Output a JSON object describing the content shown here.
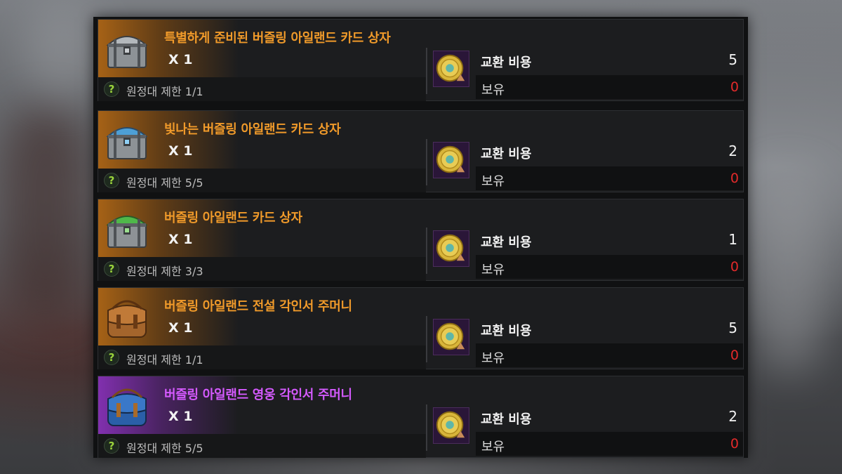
{
  "shop_rows": [
    {
      "item_icon": "silver-chest-icon",
      "item_name": "특별하게 준비된 버즐링 아일랜드 카드 상자",
      "name_color": "#f09a2a",
      "quantity": "X 1",
      "limit_text": "원정대 제한 1/1",
      "cost_label": "교환 비용",
      "cost_value": "5",
      "owned_label": "보유",
      "owned_value": "0"
    },
    {
      "item_icon": "blue-chest-icon",
      "item_name": "빛나는 버즐링 아일랜드 카드 상자",
      "name_color": "#f09a2a",
      "quantity": "X 1",
      "limit_text": "원정대 제한 5/5",
      "cost_label": "교환 비용",
      "cost_value": "2",
      "owned_label": "보유",
      "owned_value": "0"
    },
    {
      "item_icon": "green-chest-icon",
      "item_name": "버즐링 아일랜드 카드 상자",
      "name_color": "#f09a2a",
      "quantity": "X 1",
      "limit_text": "원정대 제한 3/3",
      "cost_label": "교환 비용",
      "cost_value": "1",
      "owned_label": "보유",
      "owned_value": "0"
    },
    {
      "item_icon": "brown-pouch-icon",
      "item_name": "버즐링 아일랜드 전설 각인서 주머니",
      "name_color": "#f09a2a",
      "quantity": "X 1",
      "limit_text": "원정대 제한 1/1",
      "cost_label": "교환 비용",
      "cost_value": "5",
      "owned_label": "보유",
      "owned_value": "0"
    },
    {
      "item_icon": "blue-pouch-icon",
      "item_name": "버즐링 아일랜드 영웅 각인서 주머니",
      "name_color": "#d55aff",
      "quantity": "X 1",
      "limit_text": "원정대 제한 5/5",
      "cost_label": "교환 비용",
      "cost_value": "2",
      "owned_label": "보유",
      "owned_value": "0"
    }
  ],
  "currency_icon": "gold-island-coin-icon",
  "help_icon_glyph": "?",
  "colors": {
    "legendary": "#f09a2a",
    "epic": "#d55aff",
    "insufficient": "#e22a2a",
    "help": "#9bd43c"
  }
}
